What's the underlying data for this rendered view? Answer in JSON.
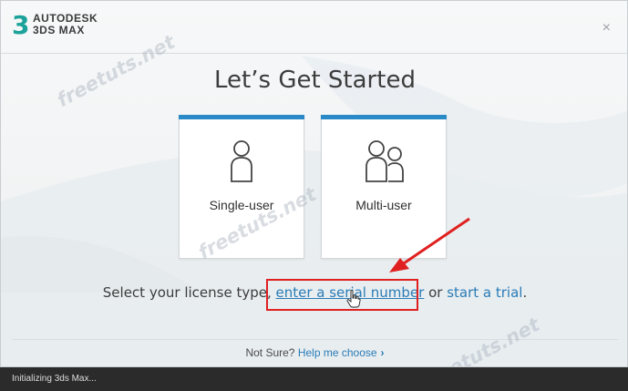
{
  "app": {
    "brand_line1": "AUTODESK",
    "brand_line2": "3DS MAX",
    "logo_glyph": "3",
    "close_glyph": "×"
  },
  "main": {
    "title": "Let’s Get Started",
    "cards": [
      {
        "label": "Single-user",
        "icon": "single-user-icon"
      },
      {
        "label": "Multi-user",
        "icon": "multi-user-icon"
      }
    ],
    "license_prefix": "Select your license type, ",
    "serial_link": "enter a serial number",
    "or_text": " or ",
    "trial_link": "start a trial",
    "period": "."
  },
  "footer": {
    "not_sure": "Not Sure?",
    "help_link": "Help me choose",
    "chevron": "›"
  },
  "status": {
    "text": "Initializing 3ds Max..."
  },
  "watermark": "freetuts.net",
  "colors": {
    "accent": "#2a8ac7",
    "link": "#2a7cb6",
    "logo": "#1ca29a",
    "annotation": "#e02020",
    "statusbar": "#2b2b2b"
  }
}
